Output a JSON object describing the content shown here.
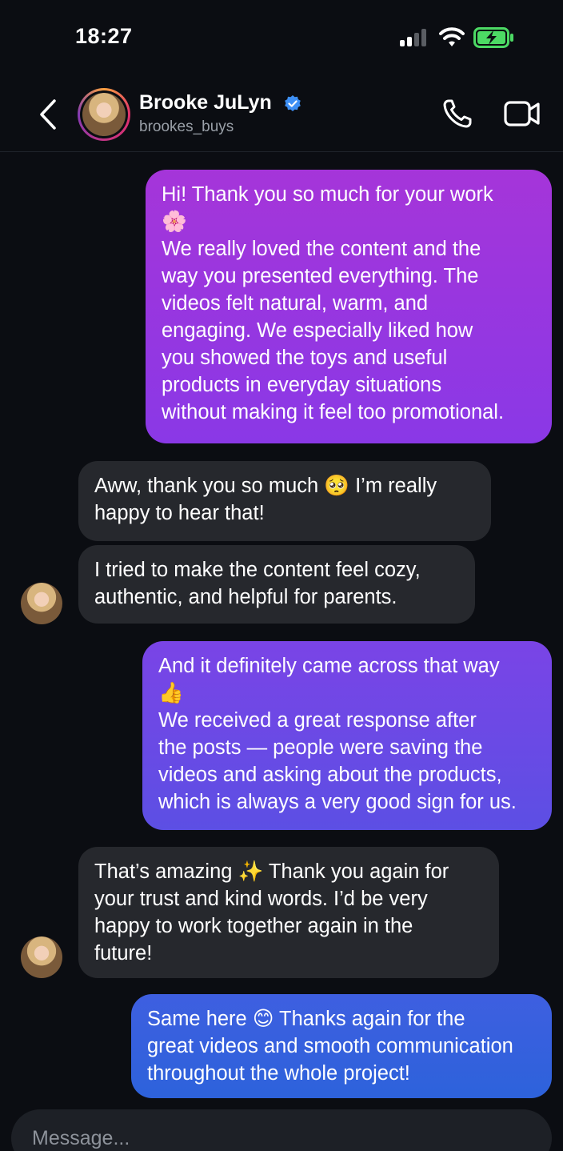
{
  "status_bar": {
    "time": "18:27",
    "icons": [
      "cellular-signal-icon",
      "wifi-icon",
      "battery-charging-icon"
    ],
    "battery_color": "#4cd964"
  },
  "header": {
    "back_icon": "chevron-left-icon",
    "contact_name": "Brooke JuLyn",
    "verified_icon": "verified-badge-icon",
    "handle": "brookes_buys",
    "call_icon": "phone-icon",
    "video_icon": "video-camera-icon"
  },
  "messages": [
    {
      "direction": "outgoing",
      "lines": [
        "Hi! Thank you so much for your work",
        "🌸",
        "We really loved the content and the",
        "way you presented everything. The",
        "videos felt natural, warm, and",
        "engaging. We especially liked how",
        "you showed the toys and useful",
        "products in everyday situations",
        "without making it feel too promotional."
      ]
    },
    {
      "direction": "incoming",
      "lines": [
        "Aww, thank you so much 🥺 I’m really",
        "happy to hear that!"
      ]
    },
    {
      "direction": "incoming",
      "lines": [
        "I tried to make the content feel cozy,",
        "authentic, and helpful for parents."
      ]
    },
    {
      "direction": "outgoing",
      "lines": [
        "And it definitely came across that way",
        "👍",
        "We received a great response after",
        "the posts — people were saving the",
        "videos and asking about the products,",
        "which is always a very good sign for us."
      ]
    },
    {
      "direction": "incoming",
      "lines": [
        "That’s amazing ✨ Thank you again for",
        "your trust and kind words. I’d be very",
        "happy to work together again in the",
        "future!"
      ]
    },
    {
      "direction": "outgoing",
      "lines": [
        "Same here 😊 Thanks again for the",
        "great videos and smooth communication",
        "throughout the whole project!"
      ]
    }
  ],
  "composer": {
    "placeholder": "Message..."
  },
  "colors": {
    "background": "#0b0d12",
    "incoming_bubble": "#26282d",
    "outgoing_purple": "#9a36e0",
    "outgoing_indigo": "#6a4ae5",
    "outgoing_blue": "#3561de"
  }
}
